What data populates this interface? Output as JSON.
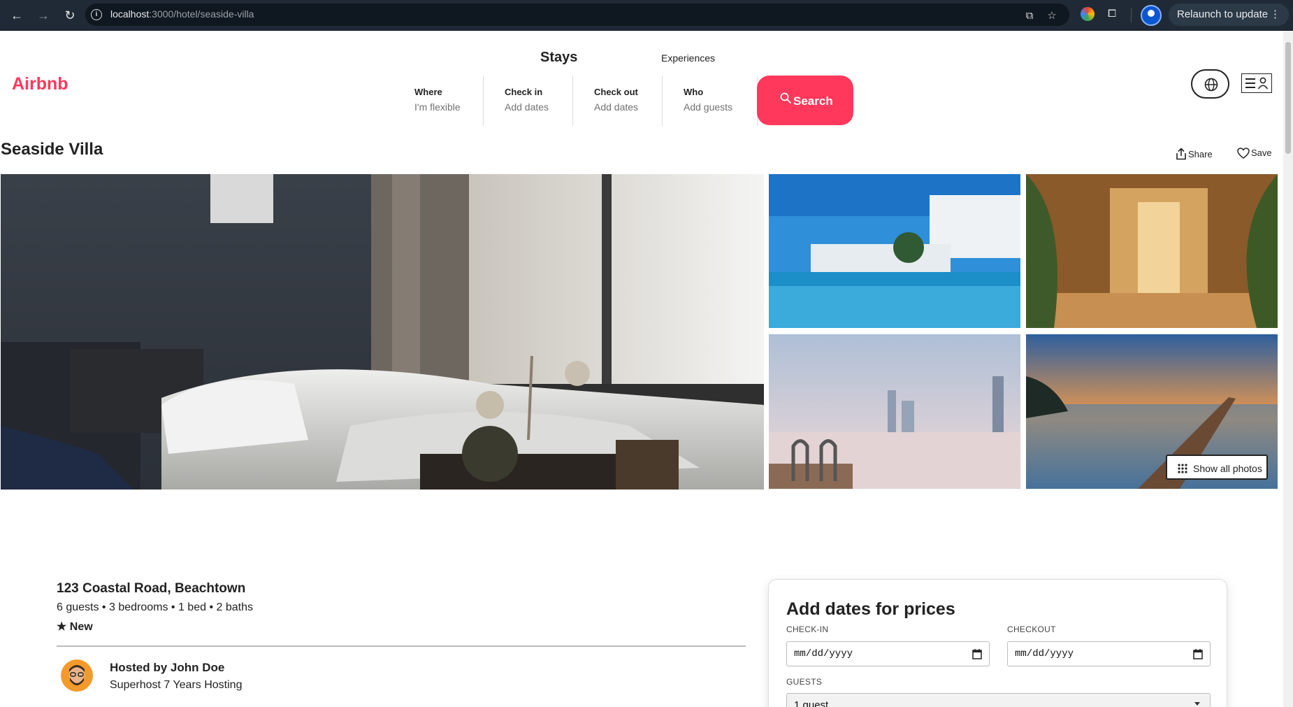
{
  "browser": {
    "url_host": "localhost",
    "url_path": ":3000/hotel/seaside-villa",
    "relaunch_label": "Relaunch to update"
  },
  "header": {
    "logo": "Airbnb",
    "tabs": {
      "stays": "Stays",
      "experiences": "Experiences"
    },
    "search": {
      "where_label": "Where",
      "where_value": "I'm flexible",
      "checkin_label": "Check in",
      "checkin_value": "Add dates",
      "checkout_label": "Check out",
      "checkout_value": "Add dates",
      "who_label": "Who",
      "who_value": "Add guests",
      "button_label": "Search"
    }
  },
  "listing": {
    "title": "Seaside Villa",
    "share_label": "Share",
    "save_label": "Save",
    "show_all_photos": "Show all photos",
    "address": "123 Coastal Road, Beachtown",
    "facts": "6 guests • 3 bedrooms • 1 bed • 2 baths",
    "rating": "★ New",
    "host_title": "Hosted by John Doe",
    "host_subtitle": "Superhost 7 Years Hosting"
  },
  "booking": {
    "heading": "Add dates for prices",
    "checkin_label": "CHECK-IN",
    "checkin_placeholder": "mm/dd/yyyy",
    "checkout_label": "CHECKOUT",
    "checkout_placeholder": "mm/dd/yyyy",
    "guests_label": "GUESTS",
    "guests_value": "1 guest"
  },
  "colors": {
    "brand": "#ff385c",
    "chrome": "#1f2a36"
  }
}
